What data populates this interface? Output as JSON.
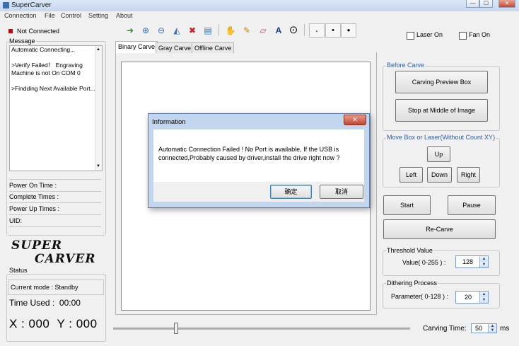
{
  "app": {
    "title": "SuperCarver"
  },
  "window_buttons": {
    "minimize": "—",
    "maximize": "☐",
    "close": "✕"
  },
  "menu": [
    "Connection",
    "File",
    "Control",
    "Setting",
    "About"
  ],
  "connection": {
    "status": "Not Connected",
    "status_color": "#d40000"
  },
  "message": {
    "label": "Message",
    "lines": [
      "Automatic Connecting...",
      "",
      ">Verify Failed！ Engraving Machine is not On COM 0",
      "",
      ">Findding Next Available Port..."
    ]
  },
  "info": {
    "power_on_time": "Power On Time :",
    "complete_times": "Complete Times :",
    "power_up_times": "Power Up Times :",
    "uid": "UID:"
  },
  "logo": {
    "line1": "SUPER",
    "line2": "CARVER"
  },
  "status": {
    "label": "Status",
    "current_mode": "Current mode : Standby",
    "time_used": "Time Used :  00:00",
    "coords": "X : 000  Y : 000"
  },
  "toolbar": {
    "icons": [
      "open-icon",
      "zoom-in-icon",
      "zoom-out-icon",
      "flip-icon",
      "delete-icon",
      "save-icon",
      "hand-icon",
      "pencil-icon",
      "eraser-icon",
      "text-icon",
      "target-icon",
      "dot-small-icon",
      "dot-medium-icon",
      "dot-large-icon"
    ],
    "glyphs": [
      "➜",
      "⊕",
      "⊖",
      "◭",
      "✖",
      "▤",
      "✋",
      "✎",
      "▱",
      "A",
      "⊙",
      "·",
      "•",
      "●"
    ]
  },
  "toggles": {
    "laser_on": "Laser On",
    "fan_on": "Fan On"
  },
  "tabs": [
    "Binary Carve",
    "Gray Carve",
    "Offline Carve"
  ],
  "before_carve": {
    "label": "Before Carve",
    "preview_box": "Carving Preview Box",
    "stop_middle": "Stop at Middle of Image"
  },
  "move_box": {
    "label": "Move Box or Laser(Without Count XY)",
    "up": "Up",
    "left": "Left",
    "down": "Down",
    "right": "Right"
  },
  "actions": {
    "start": "Start",
    "pause": "Pause",
    "recarve": "Re-Carve"
  },
  "threshold": {
    "label": "Threshold Value",
    "field_label": "Value( 0-255 ) :",
    "value": "128"
  },
  "dithering": {
    "label": "Dithering Process",
    "field_label": "Parameter( 0-128 ) :",
    "value": "20"
  },
  "carving_time": {
    "label": "Carving Time:",
    "value": "50",
    "unit": "ms"
  },
  "dialog": {
    "title": "Information",
    "close": "✕",
    "message": "Automatic Connection Failed ! No Port is available, If the USB is connected,Probably caused by driver,install the drive right now ?",
    "ok": "确定",
    "cancel": "取消"
  }
}
